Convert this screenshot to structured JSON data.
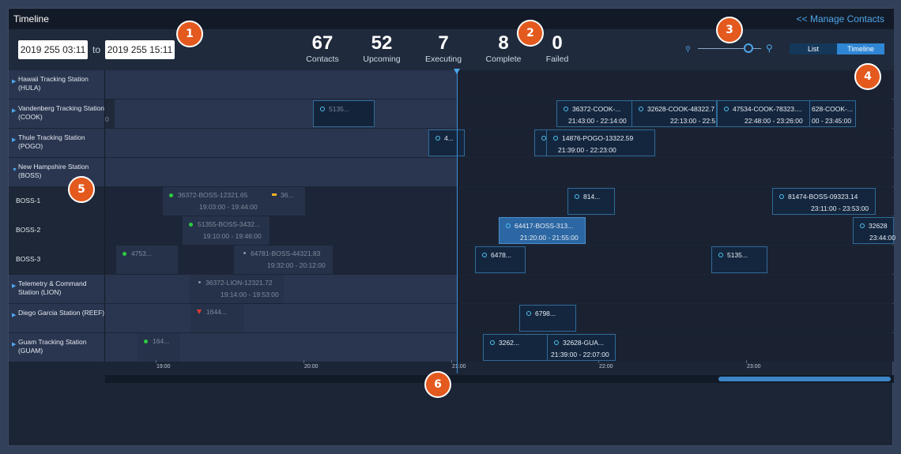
{
  "header": {
    "title": "Timeline",
    "manage_link": "<< Manage Contacts"
  },
  "date_range": {
    "from": "2019 255 03:11",
    "to_label": "to",
    "to": "2019 255 15:11"
  },
  "stats": [
    {
      "value": "67",
      "label": "Contacts"
    },
    {
      "value": "52",
      "label": "Upcoming"
    },
    {
      "value": "7",
      "label": "Executing"
    },
    {
      "value": "8",
      "label": "Complete"
    },
    {
      "value": "0",
      "label": "Failed"
    }
  ],
  "zoom": {
    "icon_small": "zoom-out-icon",
    "icon_large": "zoom-in-icon",
    "level": 0.75
  },
  "view_toggle": {
    "list": "List",
    "timeline": "Timeline",
    "selected": "Timeline"
  },
  "rows": [
    {
      "name": "Hawaii Tracking Station (HULA)",
      "type": "station",
      "expanded": false
    },
    {
      "name": "Vandenberg Tracking Station (COOK)",
      "type": "station",
      "expanded": false
    },
    {
      "name": "Thule Tracking Station (POGO)",
      "type": "station",
      "expanded": false
    },
    {
      "name": "New Hampshire Station (BOSS)",
      "type": "station",
      "expanded": true
    },
    {
      "name": "BOSS-1",
      "type": "antenna"
    },
    {
      "name": "BOSS-2",
      "type": "antenna"
    },
    {
      "name": "BOSS-3",
      "type": "antenna"
    },
    {
      "name": "Telemetry & Command Station (LION)",
      "type": "station",
      "expanded": false
    },
    {
      "name": "Diego Garcia Station (REEF)",
      "type": "station",
      "expanded": false
    },
    {
      "name": "Guam Tracking Station (GUAM)",
      "type": "station",
      "expanded": false
    }
  ],
  "passes": {
    "cook": [
      {
        "title": "5135...",
        "time": ""
      },
      {
        "title": "36372-COOK-...",
        "time": "21:43:00 - 22:14:00"
      },
      {
        "title": "32628-COOK-48322.7",
        "time": "22:13:00 - 22:5"
      },
      {
        "title": "47534-COOK-78323....",
        "time": "22:48:00 - 23:26:00"
      },
      {
        "title": "628-COOK-...",
        "time": "00 - 23:45:00"
      },
      {
        "title": "0",
        "time": ""
      }
    ],
    "pogo": [
      {
        "title": "4...",
        "time": ""
      },
      {
        "title": "14876-POGO-13322.59",
        "time": "21:39:00 - 22:23:00"
      }
    ],
    "boss1": [
      {
        "title": "36372-BOSS-12321.65",
        "time": "19:03:00 - 19:44:00"
      },
      {
        "title": "36...",
        "time": ""
      },
      {
        "title": "814...",
        "time": ""
      },
      {
        "title": "81474-BOSS-09323.14",
        "time": "23:11:00 - 23:53:00"
      }
    ],
    "boss2": [
      {
        "title": "51355-BOSS-3432...",
        "time": "19:10:00 - 19:46:00"
      },
      {
        "title": "64417-BOSS-313...",
        "time": "21:20:00 - 21:55:00"
      },
      {
        "title": "32628",
        "time": "23:44:00"
      }
    ],
    "boss3": [
      {
        "title": "4753...",
        "time": ""
      },
      {
        "title": "64781-BOSS-44321.83",
        "time": "19:32:00 - 20:12:00"
      },
      {
        "title": "6478...",
        "time": ""
      },
      {
        "title": "5135...",
        "time": ""
      }
    ],
    "lion": [
      {
        "title": "36372-LION-12321.72",
        "time": "19:14:00 - 19:53:00"
      }
    ],
    "reef": [
      {
        "title": "1644...",
        "time": ""
      },
      {
        "title": "6798...",
        "time": ""
      }
    ],
    "guam": [
      {
        "title": "164...",
        "time": ""
      },
      {
        "title": "3262...",
        "time": ""
      },
      {
        "title": "32628-GUA...",
        "time": "21:39:00 - 22:07:00"
      }
    ]
  },
  "axis_ticks": [
    "19:00",
    "20:00",
    "21:00",
    "22:00",
    "23:00"
  ],
  "callouts": [
    "1",
    "2",
    "3",
    "4",
    "5",
    "6"
  ],
  "colors": {
    "accent": "#4ea6ea",
    "callout": "#e4591d",
    "active_pass": "#2c67a3",
    "ok": "#2ecc40",
    "warn": "#f5b322",
    "error": "#e23b2e"
  }
}
